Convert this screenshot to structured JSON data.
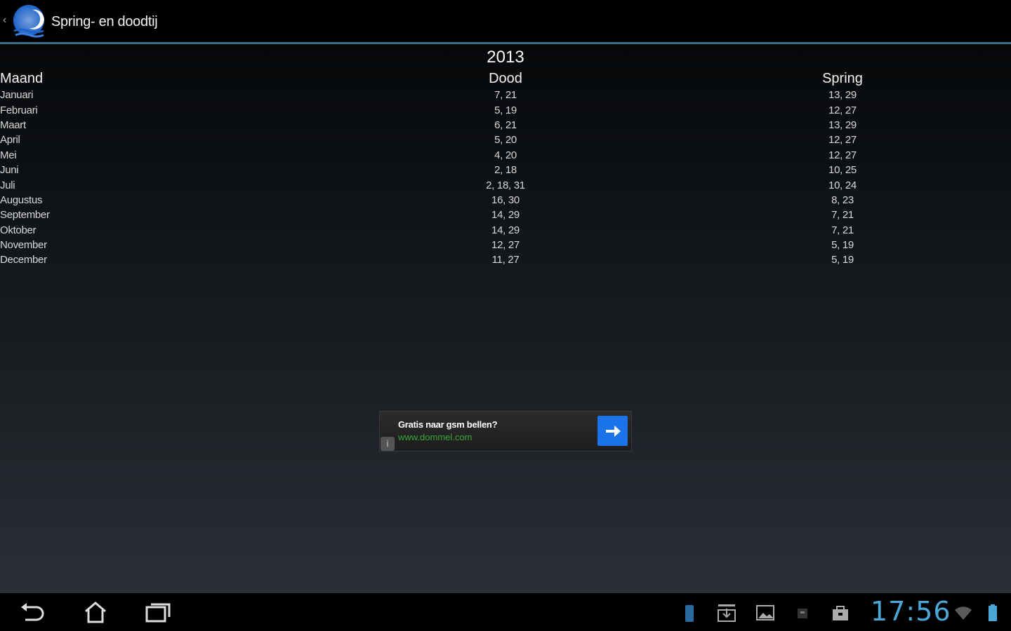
{
  "app": {
    "title": "Spring- en doodtij"
  },
  "year": "2013",
  "table": {
    "headers": {
      "month": "Maand",
      "dood": "Dood",
      "spring": "Spring"
    },
    "rows": [
      {
        "month": "Januari",
        "dood": "7, 21",
        "spring": "13, 29"
      },
      {
        "month": "Februari",
        "dood": "5, 19",
        "spring": "12, 27"
      },
      {
        "month": "Maart",
        "dood": "6, 21",
        "spring": "13, 29"
      },
      {
        "month": "April",
        "dood": "5, 20",
        "spring": "12, 27"
      },
      {
        "month": "Mei",
        "dood": "4, 20",
        "spring": "12, 27"
      },
      {
        "month": "Juni",
        "dood": "2, 18",
        "spring": "10, 25"
      },
      {
        "month": "Juli",
        "dood": "2, 18, 31",
        "spring": "10, 24"
      },
      {
        "month": "Augustus",
        "dood": "16, 30",
        "spring": "8, 23"
      },
      {
        "month": "September",
        "dood": "14, 29",
        "spring": "7, 21"
      },
      {
        "month": "Oktober",
        "dood": "14, 29",
        "spring": "7, 21"
      },
      {
        "month": "November",
        "dood": "12, 27",
        "spring": "5, 19"
      },
      {
        "month": "December",
        "dood": "11, 27",
        "spring": "5, 19"
      }
    ]
  },
  "ad": {
    "title": "Gratis naar gsm bellen?",
    "url": "www.dommel.com",
    "info_glyph": "i"
  },
  "system": {
    "clock": "17:56",
    "nav_icons": [
      "back-icon",
      "home-icon",
      "recent-apps-icon"
    ],
    "status_icons": [
      "battery-notification-icon",
      "download-icon",
      "gallery-icon",
      "notification-icon",
      "shopping-bag-icon",
      "wifi-icon",
      "battery-icon"
    ]
  },
  "colors": {
    "accent": "#3d6c86",
    "clock": "#4aa8d8",
    "ad_url": "#3aa63a",
    "ad_button": "#1a73e8"
  }
}
